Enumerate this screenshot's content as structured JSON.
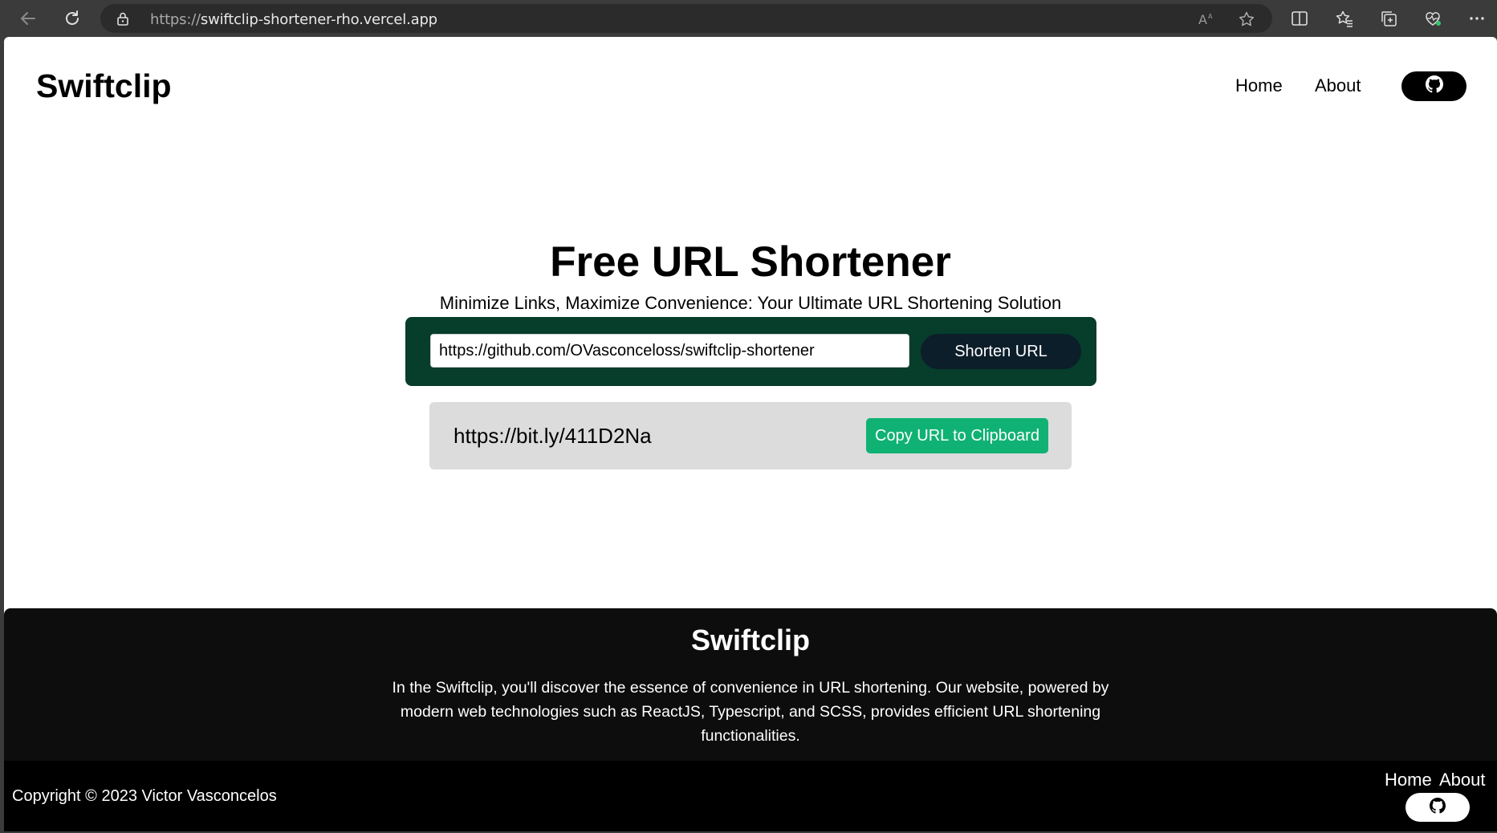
{
  "browser": {
    "url_scheme": "https://",
    "url_host": "swiftclip-shortener-rho.vercel.app",
    "icons": [
      "back-arrow-icon",
      "refresh-icon",
      "lock-icon",
      "read-aloud-icon",
      "favorite-star-icon",
      "split-screen-icon",
      "favorites-icon",
      "collections-icon",
      "browser-essentials-icon",
      "more-options-icon"
    ]
  },
  "header": {
    "logo": "Swiftclip",
    "nav": {
      "home": "Home",
      "about": "About"
    },
    "github_icon": "github-icon"
  },
  "hero": {
    "title": "Free URL Shortener",
    "subtitle": "Minimize Links, Maximize Convenience: Your Ultimate URL Shortening Solution"
  },
  "shortener": {
    "input_value": "https://github.com/OVasconceloss/swiftclip-shortener",
    "button_label": "Shorten URL"
  },
  "result": {
    "short_url": "https://bit.ly/411D2Na",
    "copy_label": "Copy URL to Clipboard"
  },
  "footer": {
    "title": "Swiftclip",
    "description": "In the Swiftclip, you'll discover the essence of convenience in URL shortening. Our website, powered by modern web technologies such as ReactJS, Typescript, and SCSS, provides efficient URL shortening functionalities.",
    "copyright": "Copyright © 2023 Victor Vasconcelos",
    "nav": {
      "home": "Home",
      "about": "About"
    }
  },
  "colors": {
    "shortener_bg": "#063d2b",
    "shorten_button": "#0c1e2a",
    "copy_button": "#10b274",
    "result_bg": "#dcdcdc",
    "footer_bg": "#0d0d0d"
  }
}
